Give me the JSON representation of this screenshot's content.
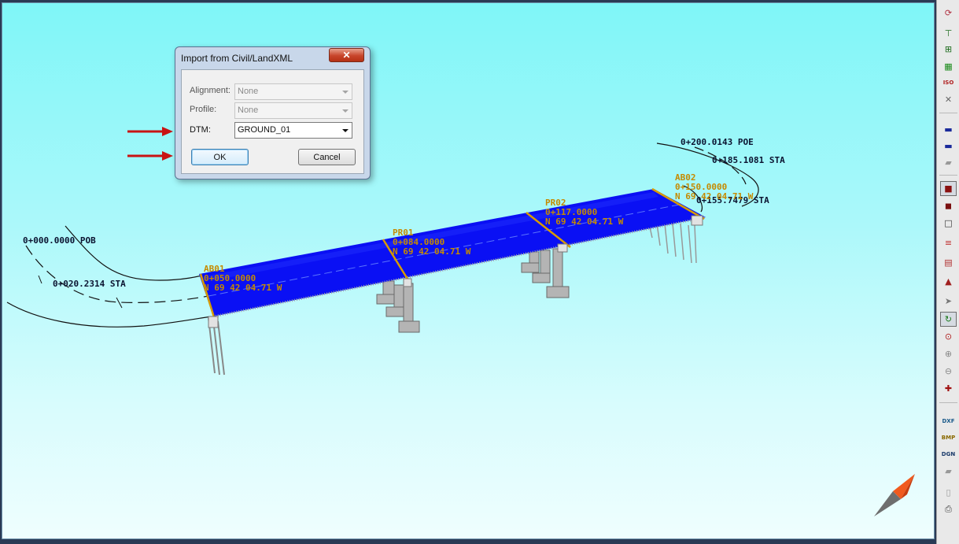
{
  "dialog": {
    "title": "Import from Civil/LandXML",
    "close_glyph": "✕",
    "fields": [
      {
        "label": "Alignment:",
        "value": "None",
        "enabled": false
      },
      {
        "label": "Profile:",
        "value": "None",
        "enabled": false
      },
      {
        "label": "DTM:",
        "value": "GROUND_01",
        "enabled": true
      }
    ],
    "ok_label": "OK",
    "cancel_label": "Cancel"
  },
  "scene": {
    "stations": {
      "pob": "0+000.0000 POB",
      "sta1": "0+020.2314 STA",
      "poe": "0+200.0143 POE",
      "sta2": "0+185.1081 STA",
      "sta3": "0+155.7479 STA"
    },
    "supports": [
      {
        "name": "AB01",
        "station": "0+050.0000",
        "bearing": "N 69 42 04.71 W"
      },
      {
        "name": "PR01",
        "station": "0+084.0000",
        "bearing": "N 69 42 04.71 W"
      },
      {
        "name": "PR02",
        "station": "0+117.0000",
        "bearing": "N 69 42 04.71 W"
      },
      {
        "name": "AB02",
        "station": "0+150.0000",
        "bearing": "N 69 42 04.71 W"
      }
    ],
    "deck_color": "#0a10f4",
    "label_gold": "#c58a00",
    "label_dark": "#0b1330"
  },
  "toolbar": {
    "icons": [
      "spiral-tool-icon",
      "tree-view-icon",
      "tree-select-icon",
      "layers-icon",
      "iso-obt-icon",
      "cross-close-icon",
      "deck-top-icon",
      "deck-bottom-icon",
      "deck-gray-icon",
      "solid-box-icon",
      "solid-shade-icon",
      "wireframe-box-icon",
      "color-bars-icon",
      "hatch-icon",
      "terrain-icon",
      "pointer-icon",
      "rotate-icon",
      "orbit-icon",
      "zoom-in-icon",
      "zoom-out-icon",
      "pan-icon",
      "export-dxf-icon",
      "export-bmp-icon",
      "export-dgn-icon",
      "save-icon",
      "print-preview-icon",
      "print-icon"
    ],
    "dxf": "DXF",
    "bmp": "BMP",
    "dgn": "DGN",
    "iso": "ISO"
  }
}
